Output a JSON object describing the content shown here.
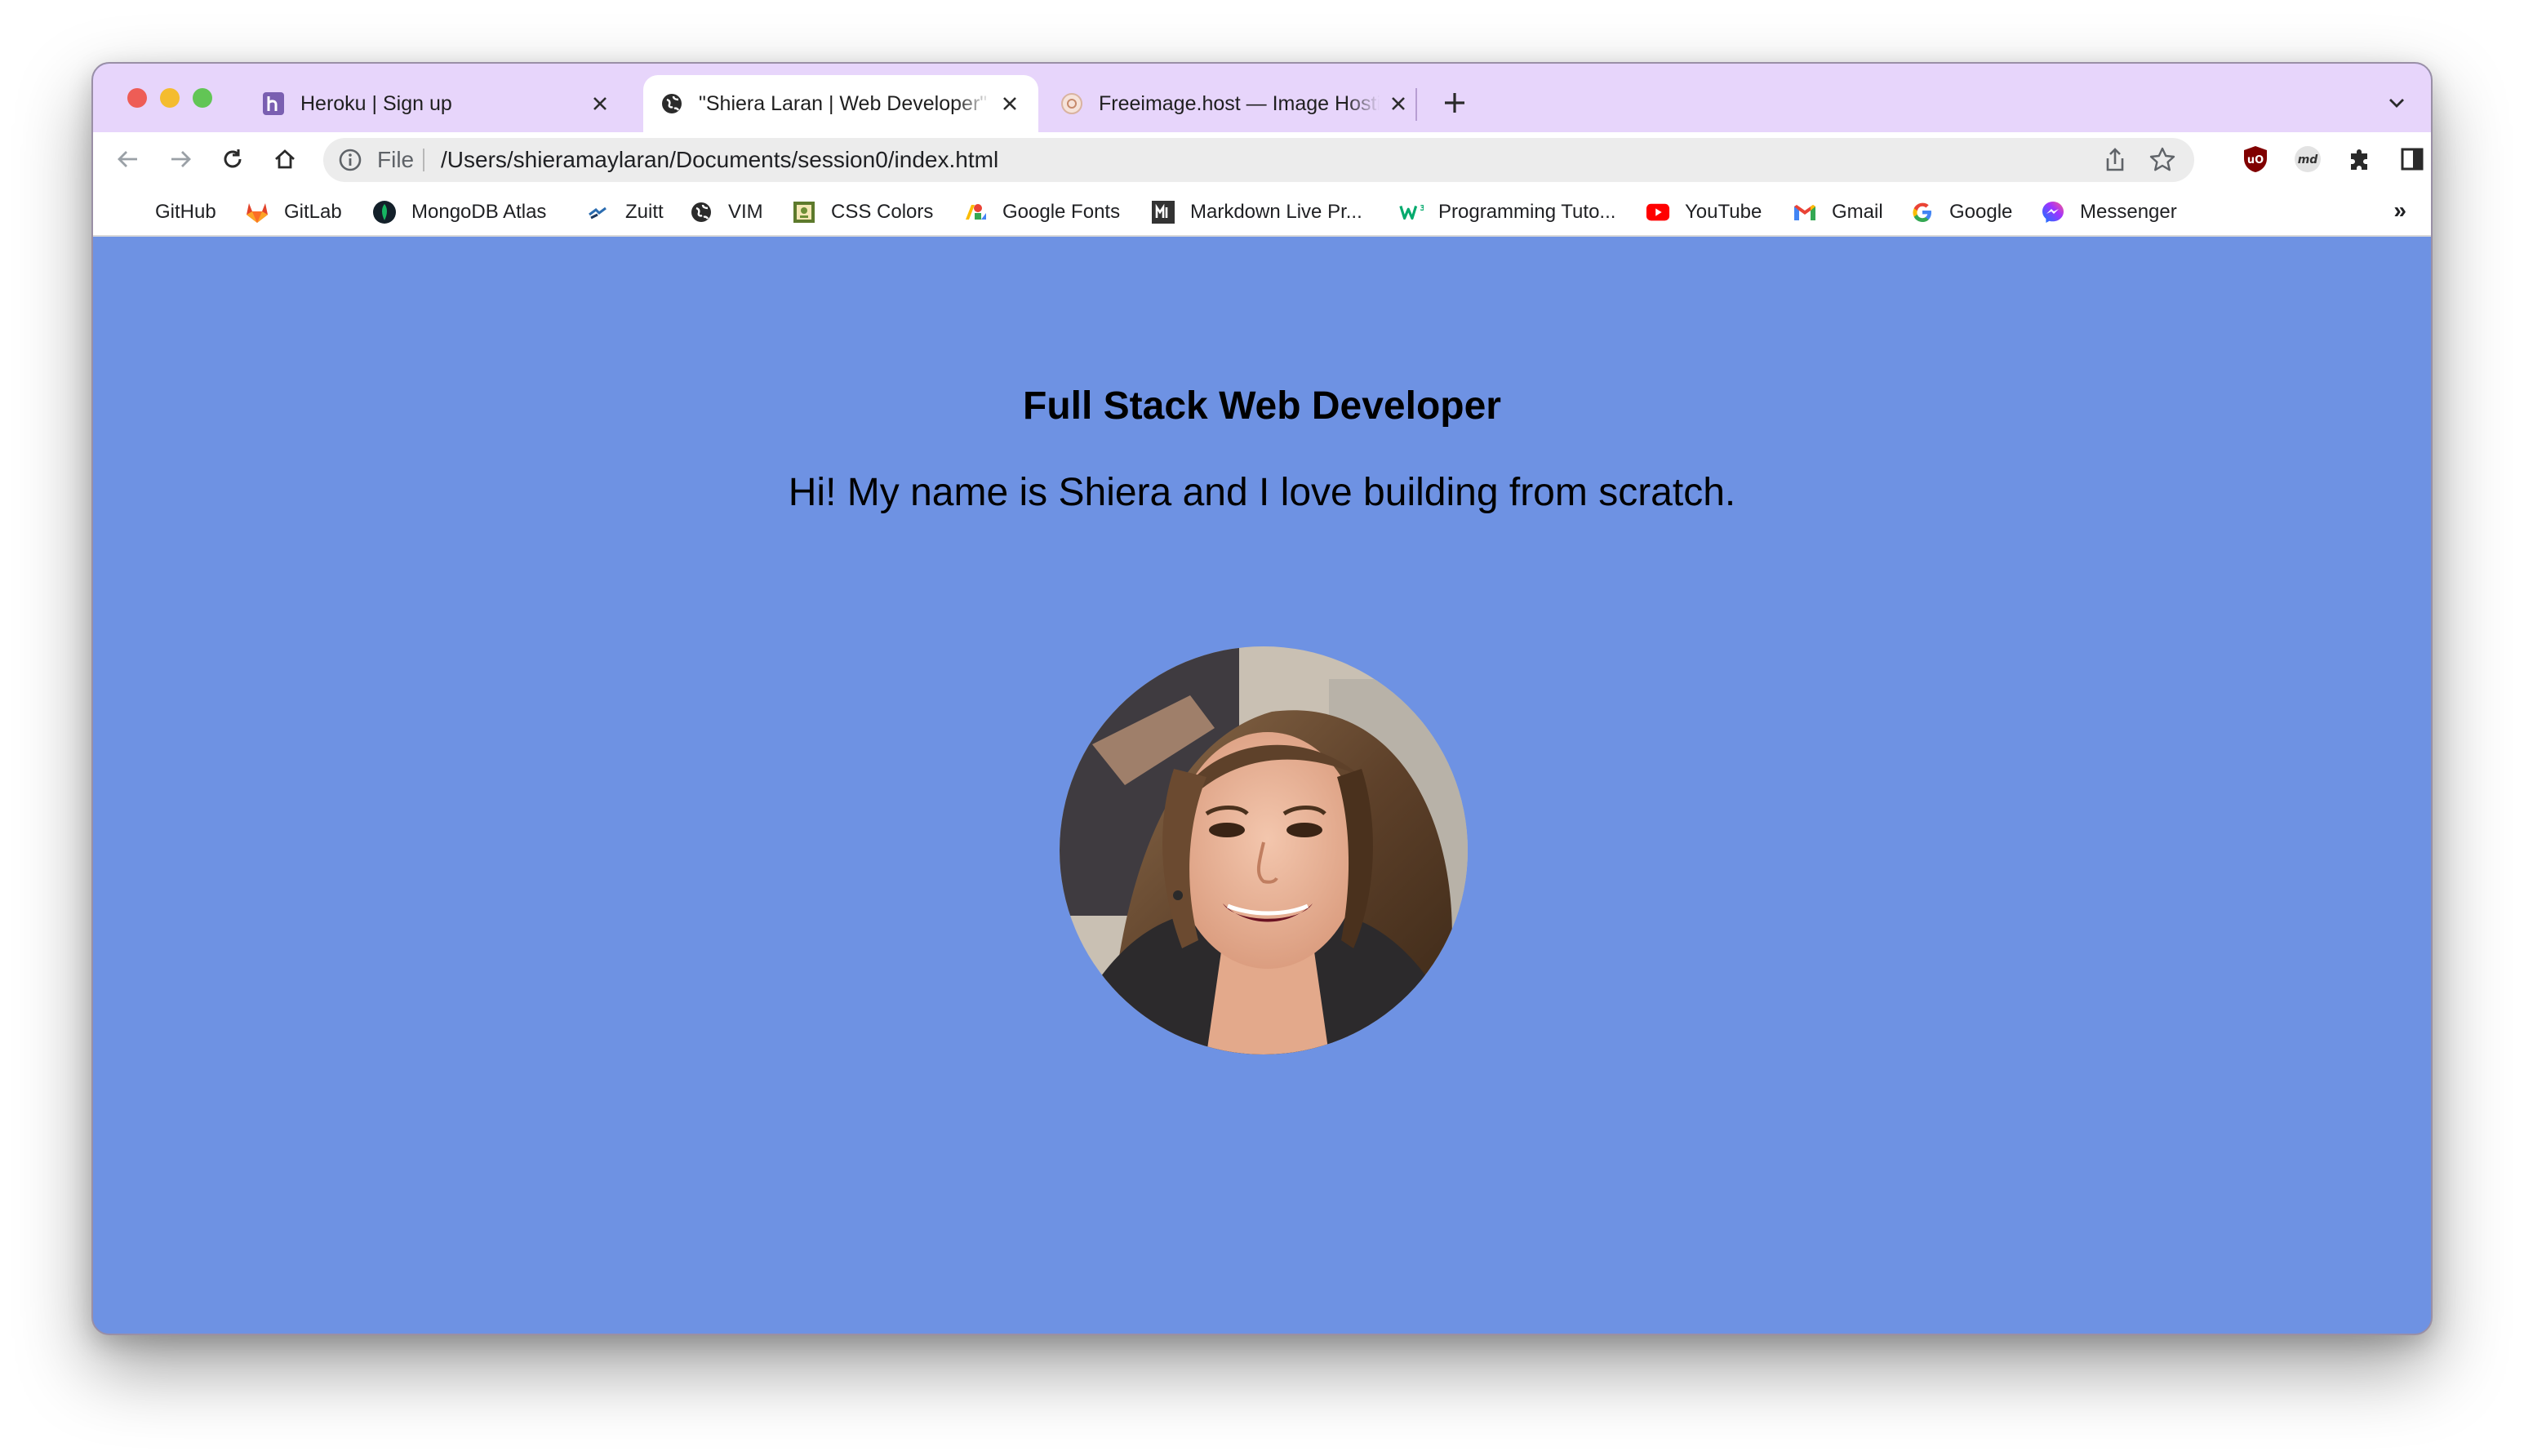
{
  "browser": {
    "tabs": [
      {
        "title": "Heroku | Sign up",
        "favicon": "heroku-icon"
      },
      {
        "title": "\"Shiera Laran | Web Developer\"",
        "favicon": "globe-icon",
        "active": true
      },
      {
        "title": "Freeimage.host — Image Hosting",
        "favicon": "freeimage-icon"
      }
    ],
    "address": {
      "scheme_label": "File",
      "url": "/Users/shieramaylaran/Documents/session0/index.html"
    },
    "bookmarks": [
      {
        "label": "GitHub",
        "icon": "github-icon"
      },
      {
        "label": "GitLab",
        "icon": "gitlab-icon"
      },
      {
        "label": "MongoDB Atlas",
        "icon": "mongodb-icon"
      },
      {
        "label": "Zuitt",
        "icon": "zuitt-icon"
      },
      {
        "label": "VIM",
        "icon": "globe-icon"
      },
      {
        "label": "CSS Colors",
        "icon": "css-colors-icon"
      },
      {
        "label": "Google Fonts",
        "icon": "google-fonts-icon"
      },
      {
        "label": "Markdown Live Pr...",
        "icon": "markdown-icon"
      },
      {
        "label": "Programming Tuto...",
        "icon": "w3-icon"
      },
      {
        "label": "YouTube",
        "icon": "youtube-icon"
      },
      {
        "label": "Gmail",
        "icon": "gmail-icon"
      },
      {
        "label": "Google",
        "icon": "google-icon"
      },
      {
        "label": "Messenger",
        "icon": "messenger-icon"
      }
    ],
    "bookmarks_overflow": "»",
    "colors": {
      "tab_strip": "#e7d5fb",
      "page_background": "#6e92e3"
    }
  },
  "page": {
    "heading": "Full Stack Web Developer",
    "tagline": "Hi! My name is Shiera and I love building from scratch.",
    "profile_photo": "profile-photo"
  }
}
